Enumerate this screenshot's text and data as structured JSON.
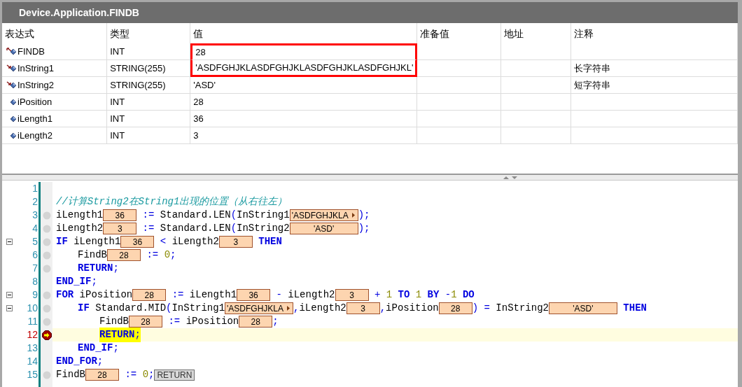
{
  "window": {
    "title": "Device.Application.FINDB"
  },
  "table": {
    "columns": [
      "表达式",
      "类型",
      "值",
      "准备值",
      "地址",
      "注释"
    ],
    "rows": [
      {
        "kind": "output",
        "expression": "FINDB",
        "type": "INT",
        "value": "28",
        "highlighted": true
      },
      {
        "kind": "input",
        "expression": "InString1",
        "type": "STRING(255)",
        "value": "'ASDFGHJKLASDFGHJKLASDFGHJKLASDFGHJKL'",
        "comment": "长字符串",
        "highlighted": true
      },
      {
        "kind": "input",
        "expression": "InString2",
        "type": "STRING(255)",
        "value": "'ASD'",
        "comment": "短字符串",
        "highlighted": false
      },
      {
        "kind": "local",
        "expression": "iPosition",
        "type": "INT",
        "value": "28",
        "highlighted": false
      },
      {
        "kind": "local",
        "expression": "iLength1",
        "type": "INT",
        "value": "36",
        "highlighted": false
      },
      {
        "kind": "local",
        "expression": "iLength2",
        "type": "INT",
        "value": "3",
        "highlighted": false
      }
    ]
  },
  "code": {
    "lines": [
      {
        "number": "1",
        "kind": "plain",
        "fold": false,
        "current": false
      },
      {
        "number": "2",
        "kind": "plain",
        "fold": false,
        "current": false,
        "tokens": [
          {
            "kind": "comment",
            "s": "//计算String2在String1出现的位置（从右往左）"
          }
        ]
      },
      {
        "number": "3",
        "kind": "slot",
        "fold": false,
        "current": false,
        "tokens": [
          {
            "kind": "identifier",
            "s": "iLength1"
          },
          {
            "kind": "value",
            "wide": false,
            "truncated": false,
            "s": "36"
          },
          {
            "kind": "operator",
            "s": " := "
          },
          {
            "kind": "identifier",
            "s": "Standard.LEN"
          },
          {
            "kind": "operator",
            "s": "("
          },
          {
            "kind": "identifier",
            "s": "InString1"
          },
          {
            "kind": "value",
            "wide": true,
            "truncated": true,
            "s": "'ASDFGHJKLA"
          },
          {
            "kind": "operator",
            "s": ");"
          }
        ]
      },
      {
        "number": "4",
        "kind": "slot",
        "fold": false,
        "current": false,
        "tokens": [
          {
            "kind": "identifier",
            "s": "iLength2"
          },
          {
            "kind": "value",
            "wide": false,
            "truncated": false,
            "s": "3"
          },
          {
            "kind": "operator",
            "s": " := "
          },
          {
            "kind": "identifier",
            "s": "Standard.LEN"
          },
          {
            "kind": "operator",
            "s": "("
          },
          {
            "kind": "identifier",
            "s": "InString2"
          },
          {
            "kind": "value",
            "wide": true,
            "truncated": false,
            "s": "'ASD'"
          },
          {
            "kind": "operator",
            "s": ");"
          }
        ]
      },
      {
        "number": "5",
        "kind": "slot",
        "fold": true,
        "current": false,
        "tokens": [
          {
            "kind": "keyword",
            "s": "IF"
          },
          {
            "kind": "identifier",
            "s": " iLength1"
          },
          {
            "kind": "value",
            "wide": false,
            "truncated": false,
            "s": "36"
          },
          {
            "kind": "operator",
            "s": " < "
          },
          {
            "kind": "identifier",
            "s": "iLength2"
          },
          {
            "kind": "value",
            "wide": false,
            "truncated": false,
            "s": "3"
          },
          {
            "kind": "keyword",
            "s": " THEN"
          }
        ],
        "children": [
          {
            "number": "6",
            "kind": "slot",
            "fold": false,
            "current": false,
            "tokens": [
              {
                "kind": "identifier",
                "s": "FindB"
              },
              {
                "kind": "value",
                "wide": false,
                "truncated": false,
                "s": "28"
              },
              {
                "kind": "operator",
                "s": " := "
              },
              {
                "kind": "number",
                "s": "0"
              },
              {
                "kind": "operator",
                "s": ";"
              }
            ]
          },
          {
            "number": "7",
            "kind": "slot",
            "fold": false,
            "current": false,
            "tokens": [
              {
                "kind": "keyword",
                "s": "RETURN"
              },
              {
                "kind": "operator",
                "s": ";"
              }
            ]
          }
        ]
      },
      {
        "number": "8",
        "kind": "plain",
        "fold": false,
        "current": false,
        "tokens": [
          {
            "kind": "keyword",
            "s": "END_IF"
          },
          {
            "kind": "operator",
            "s": ";"
          }
        ]
      },
      {
        "number": "9",
        "kind": "slot",
        "fold": true,
        "current": false,
        "tokens": [
          {
            "kind": "keyword",
            "s": "FOR"
          },
          {
            "kind": "identifier",
            "s": " iPosition"
          },
          {
            "kind": "value",
            "wide": false,
            "truncated": false,
            "s": "28"
          },
          {
            "kind": "operator",
            "s": " := "
          },
          {
            "kind": "identifier",
            "s": "iLength1"
          },
          {
            "kind": "value",
            "wide": false,
            "truncated": false,
            "s": "36"
          },
          {
            "kind": "operator",
            "s": " - "
          },
          {
            "kind": "identifier",
            "s": "iLength2"
          },
          {
            "kind": "value",
            "wide": false,
            "truncated": false,
            "s": "3"
          },
          {
            "kind": "operator",
            "s": " + "
          },
          {
            "kind": "number",
            "s": "1"
          },
          {
            "kind": "keyword",
            "s": " TO "
          },
          {
            "kind": "number",
            "s": "1"
          },
          {
            "kind": "keyword",
            "s": " BY "
          },
          {
            "kind": "operator",
            "s": "-"
          },
          {
            "kind": "number",
            "s": "1"
          },
          {
            "kind": "keyword",
            "s": " DO"
          }
        ],
        "children": [
          {
            "number": "10",
            "kind": "slot",
            "fold": true,
            "current": false,
            "tokens": [
              {
                "kind": "keyword",
                "s": "IF"
              },
              {
                "kind": "identifier",
                "s": " Standard.MID"
              },
              {
                "kind": "operator",
                "s": "("
              },
              {
                "kind": "identifier",
                "s": "InString1"
              },
              {
                "kind": "value",
                "wide": true,
                "truncated": true,
                "s": "'ASDFGHJKLA"
              },
              {
                "kind": "operator",
                "s": ","
              },
              {
                "kind": "identifier",
                "s": "iLength2"
              },
              {
                "kind": "value",
                "wide": false,
                "truncated": false,
                "s": "3"
              },
              {
                "kind": "operator",
                "s": ","
              },
              {
                "kind": "identifier",
                "s": "iPosition"
              },
              {
                "kind": "value",
                "wide": false,
                "truncated": false,
                "s": "28"
              },
              {
                "kind": "operator",
                "s": ") = "
              },
              {
                "kind": "identifier",
                "s": "InString2"
              },
              {
                "kind": "value",
                "wide": true,
                "truncated": false,
                "s": "'ASD'"
              },
              {
                "kind": "keyword",
                "s": " THEN"
              }
            ],
            "children": [
              {
                "number": "11",
                "kind": "slot",
                "fold": false,
                "current": false,
                "tokens": [
                  {
                    "kind": "identifier",
                    "s": "FindB"
                  },
                  {
                    "kind": "value",
                    "wide": false,
                    "truncated": false,
                    "s": "28"
                  },
                  {
                    "kind": "operator",
                    "s": " := "
                  },
                  {
                    "kind": "identifier",
                    "s": "iPosition"
                  },
                  {
                    "kind": "value",
                    "wide": false,
                    "truncated": false,
                    "s": "28"
                  },
                  {
                    "kind": "operator",
                    "s": ";"
                  }
                ]
              },
              {
                "number": "12",
                "kind": "current",
                "fold": false,
                "current": true,
                "tokens": [
                  {
                    "kind": "keyword",
                    "s": "RETURN"
                  },
                  {
                    "kind": "operator",
                    "s": ";"
                  }
                ]
              }
            ]
          },
          {
            "number": "13",
            "kind": "plain",
            "fold": false,
            "current": false,
            "tokens": [
              {
                "kind": "keyword",
                "s": "END_IF"
              },
              {
                "kind": "operator",
                "s": ";"
              }
            ]
          }
        ]
      },
      {
        "number": "14",
        "kind": "plain",
        "fold": false,
        "current": false,
        "tokens": [
          {
            "kind": "keyword",
            "s": "END_FOR"
          },
          {
            "kind": "operator",
            "s": ";"
          }
        ]
      },
      {
        "number": "15",
        "kind": "slot",
        "fold": false,
        "current": false,
        "tokens": [
          {
            "kind": "identifier",
            "s": "FindB"
          },
          {
            "kind": "value",
            "wide": false,
            "truncated": false,
            "s": "28"
          },
          {
            "kind": "operator",
            "s": " := "
          },
          {
            "kind": "number",
            "s": "0"
          },
          {
            "kind": "operator",
            "s": ";"
          },
          {
            "kind": "flag",
            "s": "RETURN"
          }
        ]
      }
    ]
  }
}
